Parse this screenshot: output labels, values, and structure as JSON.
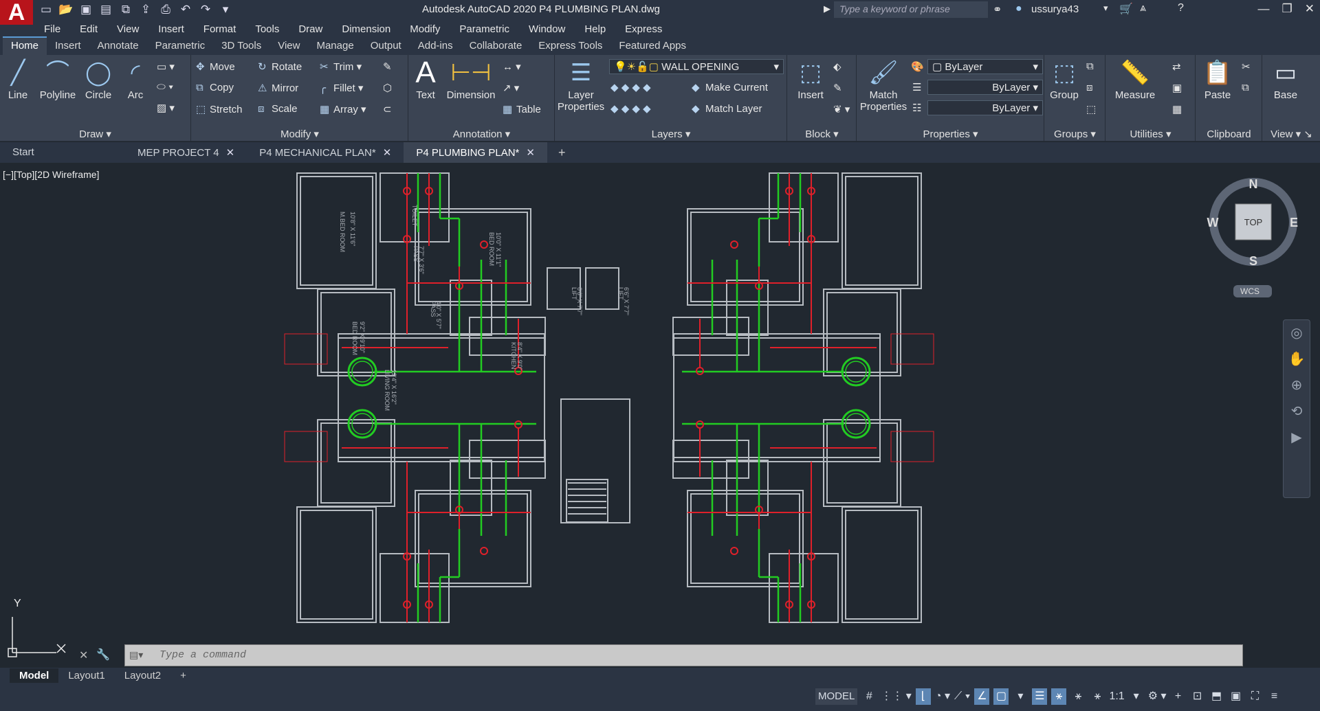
{
  "app": {
    "logo_letter": "A",
    "title": "Autodesk AutoCAD 2020    P4 PLUMBING PLAN.dwg",
    "search_placeholder": "Type a keyword or phrase",
    "username": "ussurya43"
  },
  "menu": [
    "File",
    "Edit",
    "View",
    "Insert",
    "Format",
    "Tools",
    "Draw",
    "Dimension",
    "Modify",
    "Parametric",
    "Window",
    "Help",
    "Express"
  ],
  "ribbon_tabs": [
    "Home",
    "Insert",
    "Annotate",
    "Parametric",
    "3D Tools",
    "View",
    "Manage",
    "Output",
    "Add-ins",
    "Collaborate",
    "Express Tools",
    "Featured Apps"
  ],
  "ribbon": {
    "draw": {
      "title": "Draw",
      "line": "Line",
      "polyline": "Polyline",
      "circle": "Circle",
      "arc": "Arc"
    },
    "modify": {
      "title": "Modify",
      "move": "Move",
      "rotate": "Rotate",
      "trim": "Trim",
      "copy": "Copy",
      "mirror": "Mirror",
      "fillet": "Fillet",
      "stretch": "Stretch",
      "scale": "Scale",
      "array": "Array"
    },
    "annotation": {
      "title": "Annotation",
      "text": "Text",
      "dimension": "Dimension",
      "table": "Table"
    },
    "layers": {
      "title": "Layers",
      "layer_properties": "Layer Properties",
      "current_layer": "WALL OPENING",
      "make_current": "Make Current",
      "match_layer": "Match Layer"
    },
    "block": {
      "title": "Block",
      "insert": "Insert"
    },
    "properties": {
      "title": "Properties",
      "match_properties": "Match Properties",
      "color": "ByLayer",
      "linetype": "ByLayer",
      "lineweight": "ByLayer"
    },
    "groups": {
      "title": "Groups",
      "group": "Group"
    },
    "utilities": {
      "title": "Utilities",
      "measure": "Measure"
    },
    "clipboard": {
      "title": "Clipboard",
      "paste": "Paste"
    },
    "view": {
      "title": "View",
      "base": "Base"
    }
  },
  "doc_tabs": [
    {
      "label": "Start",
      "closable": false,
      "active": false
    },
    {
      "label": "MEP PROJECT 4",
      "closable": true,
      "active": false
    },
    {
      "label": "P4 MECHANICAL PLAN*",
      "closable": true,
      "active": false
    },
    {
      "label": "P4 PLUMBING PLAN*",
      "closable": true,
      "active": true
    }
  ],
  "viewport_label": "[−][Top][2D Wireframe]",
  "viewcube": {
    "face": "TOP",
    "n": "N",
    "s": "S",
    "e": "E",
    "w": "W",
    "wcs": "WCS"
  },
  "ucs": {
    "y": "Y",
    "x": "X"
  },
  "command_placeholder": "Type a command",
  "layout_tabs": [
    "Model",
    "Layout1",
    "Layout2"
  ],
  "status": {
    "model": "MODEL",
    "scale": "1:1"
  },
  "rooms": {
    "m_bed": "M.BED ROOM",
    "m_bed_dim": "10'8\" X 11'6\"",
    "bed": "BED ROOM",
    "bed_dim": "9'2\" X 9'10\"",
    "bed2_dim": "10'0\" X 11'1\"",
    "toilet": "TOILET",
    "pass": "PASS",
    "pass_dim": "7'7\" X 3'6\"",
    "pass2_dim": "4'0\" X 5'7\"",
    "kitchen": "KITCHEN",
    "kitchen_dim": "8'4\" X 9'0\"",
    "living": "LIVING ROOM",
    "living_dim": "12'4\" X 16'2\"",
    "lift": "LIFT",
    "lift_dim": "6'6\" X 7'7\""
  },
  "colors": {
    "wall": "#b7bcc2",
    "supply": "#22cc22",
    "drain": "#e0202a",
    "fixture": "#e0202a",
    "canvas": "#212830"
  }
}
